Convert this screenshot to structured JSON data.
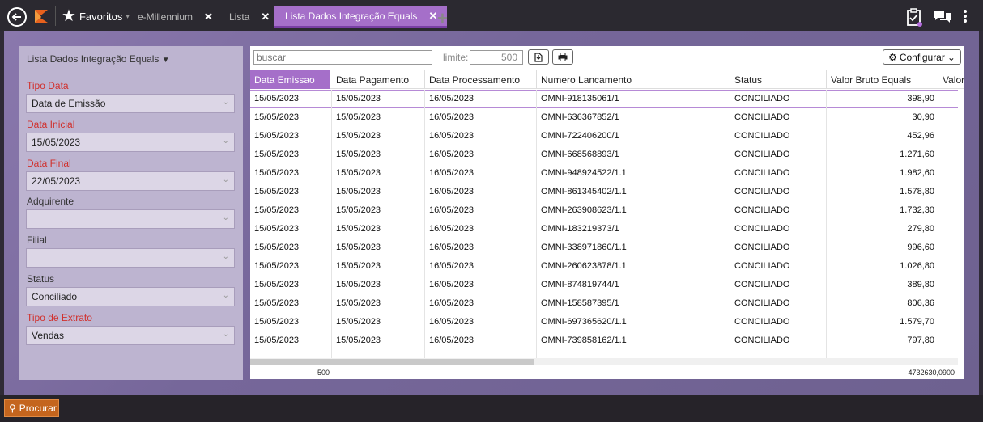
{
  "topbar": {
    "favorites_label": "Favoritos",
    "tabs": [
      {
        "label": "e-Millennium"
      },
      {
        "label": "Lista"
      },
      {
        "label": "Lista Dados Integração Equals"
      }
    ]
  },
  "panel": {
    "title": "Lista Dados Integração Equals",
    "fields": [
      {
        "label": "Tipo Data",
        "value": "Data de Emissão"
      },
      {
        "label": "Data Inicial",
        "value": "15/05/2023"
      },
      {
        "label": "Data Final",
        "value": "22/05/2023"
      },
      {
        "label": "Adquirente",
        "value": ""
      },
      {
        "label": "Filial",
        "value": ""
      },
      {
        "label": "Status",
        "value": "Conciliado"
      },
      {
        "label": "Tipo de Extrato",
        "value": "Vendas"
      }
    ]
  },
  "toolbar": {
    "search_placeholder": "buscar",
    "limit_label": "limite:",
    "limit_value": "500",
    "config_label": "Configurar"
  },
  "grid": {
    "columns": [
      "Data Emissao",
      "Data Pagamento",
      "Data Processamento",
      "Numero Lancamento",
      "Status",
      "Valor Bruto Equals",
      "Valor"
    ],
    "rows": [
      [
        "15/05/2023",
        "15/05/2023",
        "16/05/2023",
        "OMNI-918135061/1",
        "CONCILIADO",
        "398,90"
      ],
      [
        "15/05/2023",
        "15/05/2023",
        "16/05/2023",
        "OMNI-636367852/1",
        "CONCILIADO",
        "30,90"
      ],
      [
        "15/05/2023",
        "15/05/2023",
        "16/05/2023",
        "OMNI-722406200/1",
        "CONCILIADO",
        "452,96"
      ],
      [
        "15/05/2023",
        "15/05/2023",
        "16/05/2023",
        "OMNI-668568893/1",
        "CONCILIADO",
        "1.271,60"
      ],
      [
        "15/05/2023",
        "15/05/2023",
        "16/05/2023",
        "OMNI-948924522/1.1",
        "CONCILIADO",
        "1.982,60"
      ],
      [
        "15/05/2023",
        "15/05/2023",
        "16/05/2023",
        "OMNI-861345402/1.1",
        "CONCILIADO",
        "1.578,80"
      ],
      [
        "15/05/2023",
        "15/05/2023",
        "16/05/2023",
        "OMNI-263908623/1.1",
        "CONCILIADO",
        "1.732,30"
      ],
      [
        "15/05/2023",
        "15/05/2023",
        "16/05/2023",
        "OMNI-183219373/1",
        "CONCILIADO",
        "279,80"
      ],
      [
        "15/05/2023",
        "15/05/2023",
        "16/05/2023",
        "OMNI-338971860/1.1",
        "CONCILIADO",
        "996,60"
      ],
      [
        "15/05/2023",
        "15/05/2023",
        "16/05/2023",
        "OMNI-260623878/1.1",
        "CONCILIADO",
        "1.026,80"
      ],
      [
        "15/05/2023",
        "15/05/2023",
        "16/05/2023",
        "OMNI-874819744/1",
        "CONCILIADO",
        "389,80"
      ],
      [
        "15/05/2023",
        "15/05/2023",
        "16/05/2023",
        "OMNI-158587395/1",
        "CONCILIADO",
        "806,36"
      ],
      [
        "15/05/2023",
        "15/05/2023",
        "16/05/2023",
        "OMNI-697365620/1.1",
        "CONCILIADO",
        "1.579,70"
      ],
      [
        "15/05/2023",
        "15/05/2023",
        "16/05/2023",
        "OMNI-739858162/1.1",
        "CONCILIADO",
        "797,80"
      ]
    ],
    "footer_count": "500",
    "footer_total": "4732630,0900"
  },
  "bottom": {
    "search_button": "Procurar"
  }
}
